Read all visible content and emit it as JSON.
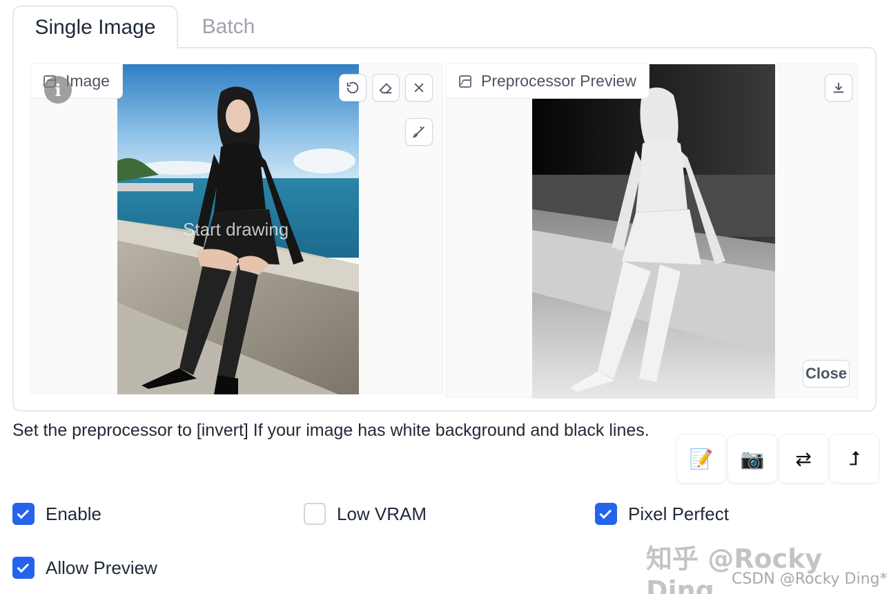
{
  "tabs": [
    {
      "label": "Single Image",
      "active": true
    },
    {
      "label": "Batch",
      "active": false
    }
  ],
  "input_box": {
    "label": "Image",
    "overlay_text": "Start drawing",
    "info_badge": "i",
    "icons": [
      "undo-icon",
      "eraser-icon",
      "close-icon",
      "brush-icon"
    ]
  },
  "preview_box": {
    "label": "Preprocessor Preview",
    "icons": [
      "download-icon"
    ],
    "close_label": "Close"
  },
  "hint_text": "Set the preprocessor to [invert] If your image has white background and black lines.",
  "tool_buttons": [
    {
      "name": "memo-icon",
      "glyph": "📝"
    },
    {
      "name": "camera-icon",
      "glyph": "📷"
    },
    {
      "name": "swap-icon",
      "glyph": "⇄"
    },
    {
      "name": "send-up-icon",
      "glyph": "⮥"
    }
  ],
  "checkboxes": [
    {
      "label": "Enable",
      "checked": true
    },
    {
      "label": "Low VRAM",
      "checked": false
    },
    {
      "label": "Pixel Perfect",
      "checked": true
    },
    {
      "label": "Allow Preview",
      "checked": true
    }
  ],
  "watermarks": {
    "zhihu": "知乎 @Rocky Ding",
    "csdn": "CSDN @Rocky Ding*"
  },
  "colors": {
    "accent": "#2563eb",
    "border": "#e5e7eb",
    "muted_text": "#9ca3af"
  }
}
